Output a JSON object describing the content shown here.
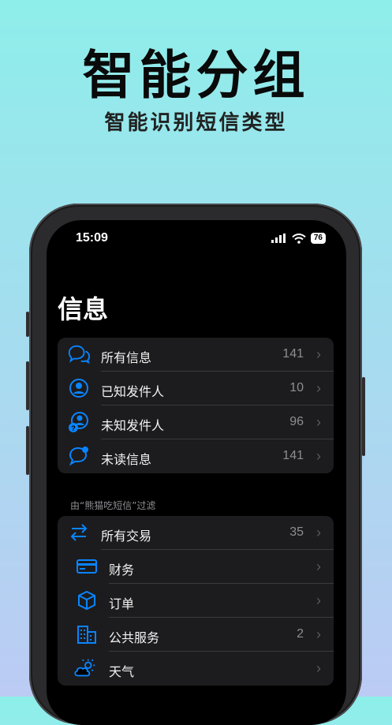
{
  "promo": {
    "headline": "智能分组",
    "subline": "智能识别短信类型"
  },
  "status_bar": {
    "time": "15:09",
    "battery": "76"
  },
  "page": {
    "title": "信息"
  },
  "colors": {
    "accent": "#0a84ff",
    "background": "#000000",
    "cell": "#1c1c1e"
  },
  "group1": [
    {
      "label": "所有信息",
      "count": "141",
      "icon": "chat-bubbles-icon"
    },
    {
      "label": "已知发件人",
      "count": "10",
      "icon": "person-circle-icon"
    },
    {
      "label": "未知发件人",
      "count": "96",
      "icon": "unknown-person-icon"
    },
    {
      "label": "未读信息",
      "count": "141",
      "icon": "unread-bubble-icon"
    }
  ],
  "filter_label": "由“熊猫吃短信”过滤",
  "group2": [
    {
      "label": "所有交易",
      "count": "35",
      "icon": "arrows-exchange-icon"
    },
    {
      "label": "财务",
      "count": "",
      "icon": "credit-card-icon"
    },
    {
      "label": "订单",
      "count": "",
      "icon": "package-box-icon"
    },
    {
      "label": "公共服务",
      "count": "2",
      "icon": "building-icon"
    },
    {
      "label": "天气",
      "count": "",
      "icon": "cloud-sun-icon"
    }
  ]
}
